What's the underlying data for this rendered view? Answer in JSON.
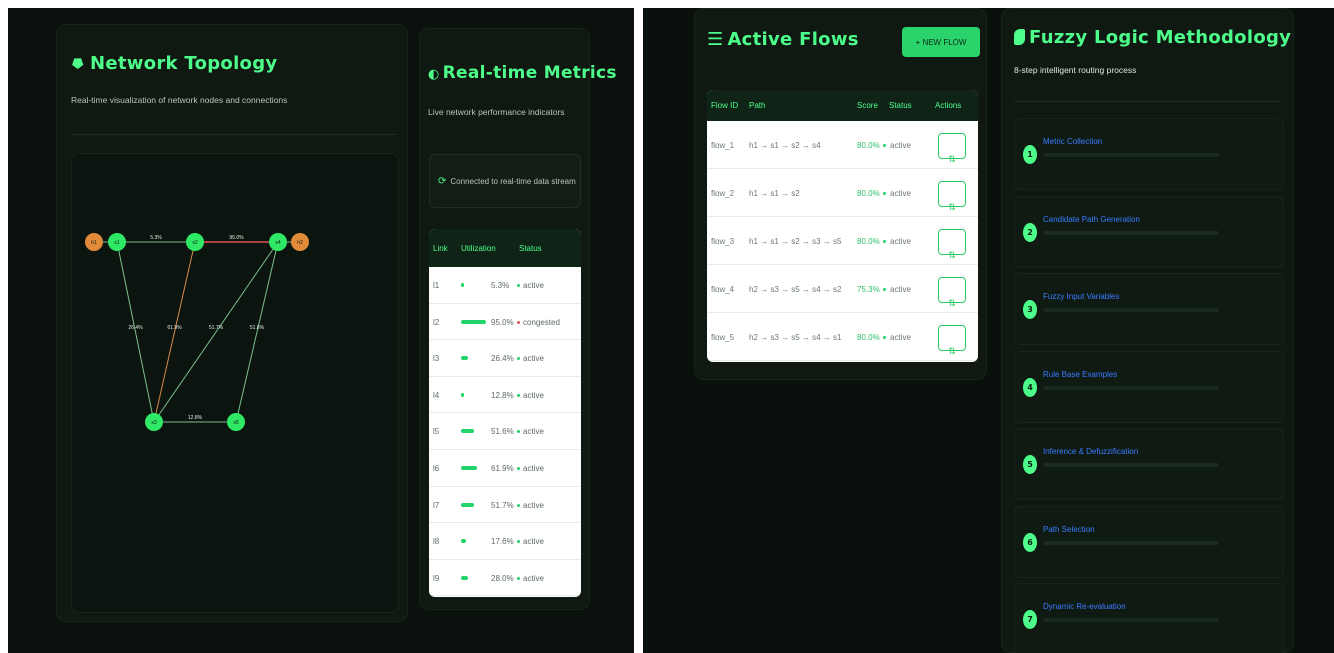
{
  "topology": {
    "title": "Network Topology",
    "subtitle": "Real-time visualization of network nodes and connections",
    "icon": "network-icon",
    "nodes": [
      {
        "id": "h1",
        "kind": "host"
      },
      {
        "id": "s1",
        "kind": "switch"
      },
      {
        "id": "s2",
        "kind": "switch"
      },
      {
        "id": "s4",
        "kind": "switch"
      },
      {
        "id": "h2",
        "kind": "host"
      },
      {
        "id": "s3",
        "kind": "switch"
      },
      {
        "id": "s5",
        "kind": "switch"
      }
    ],
    "links": [
      {
        "from": "s1",
        "to": "s2",
        "label": "5.3%",
        "status": "active"
      },
      {
        "from": "s2",
        "to": "s4",
        "label": "95.0%",
        "status": "congested"
      },
      {
        "from": "s1",
        "to": "s3",
        "label": "26.4%",
        "status": "active"
      },
      {
        "from": "s2",
        "to": "s3",
        "label": "61.9%",
        "status": "warning"
      },
      {
        "from": "s4",
        "to": "s3",
        "label": "51.7%",
        "status": "active"
      },
      {
        "from": "s4",
        "to": "s5",
        "label": "51.6%",
        "status": "active"
      },
      {
        "from": "s3",
        "to": "s5",
        "label": "12.8%",
        "status": "active"
      }
    ]
  },
  "metrics": {
    "title": "Real-time Metrics",
    "subtitle": "Live network performance indicators",
    "connection_status": "Connected to real-time data stream",
    "headers": {
      "link": "Link",
      "utilization": "Utilization",
      "status": "Status"
    },
    "rows": [
      {
        "link": "l1",
        "utilization": 5.3,
        "value": "5.3%",
        "status": "active"
      },
      {
        "link": "l2",
        "utilization": 95.0,
        "value": "95.0%",
        "status": "congested"
      },
      {
        "link": "l3",
        "utilization": 26.4,
        "value": "26.4%",
        "status": "active"
      },
      {
        "link": "l4",
        "utilization": 12.8,
        "value": "12.8%",
        "status": "active"
      },
      {
        "link": "l5",
        "utilization": 51.6,
        "value": "51.6%",
        "status": "active"
      },
      {
        "link": "l6",
        "utilization": 61.9,
        "value": "61.9%",
        "status": "active"
      },
      {
        "link": "l7",
        "utilization": 51.7,
        "value": "51.7%",
        "status": "active"
      },
      {
        "link": "l8",
        "utilization": 17.6,
        "value": "17.6%",
        "status": "active"
      },
      {
        "link": "l9",
        "utilization": 28.0,
        "value": "28.0%",
        "status": "active"
      }
    ]
  },
  "flows": {
    "title": "Active Flows",
    "new_flow_label": "+ NEW FLOW",
    "headers": {
      "id": "Flow ID",
      "path": "Path",
      "score": "Score",
      "status": "Status",
      "actions": "Actions"
    },
    "rows": [
      {
        "id": "flow_1",
        "path": "h1 → s1 → s2 → s4",
        "score": "80.0%",
        "status": "active"
      },
      {
        "id": "flow_2",
        "path": "h1 → s1 → s2",
        "score": "80.0%",
        "status": "active"
      },
      {
        "id": "flow_3",
        "path": "h1 → s1 → s2 → s3 → s5",
        "score": "80.0%",
        "status": "active"
      },
      {
        "id": "flow_4",
        "path": "h2 → s3 → s5 → s4 → s2",
        "score": "75.3%",
        "status": "active"
      },
      {
        "id": "flow_5",
        "path": "h2 → s3 → s5 → s4 → s1",
        "score": "80.0%",
        "status": "active"
      }
    ]
  },
  "fuzzy": {
    "title": "Fuzzy Logic Methodology",
    "subtitle": "8-step intelligent routing process",
    "steps": [
      {
        "num": "1",
        "name": "Metric Collection"
      },
      {
        "num": "2",
        "name": "Candidate Path Generation"
      },
      {
        "num": "3",
        "name": "Fuzzy Input Variables"
      },
      {
        "num": "4",
        "name": "Rule Base Examples"
      },
      {
        "num": "5",
        "name": "Inference & Defuzzification"
      },
      {
        "num": "6",
        "name": "Path Selection"
      },
      {
        "num": "7",
        "name": "Dynamic Re-evaluation"
      }
    ]
  },
  "colors": {
    "accent": "#4dff8a",
    "switch": "#2ee866",
    "host": "#e08a3a",
    "congested": "#e05252",
    "warning": "#d98a4a",
    "link": "#7bbf8c"
  }
}
